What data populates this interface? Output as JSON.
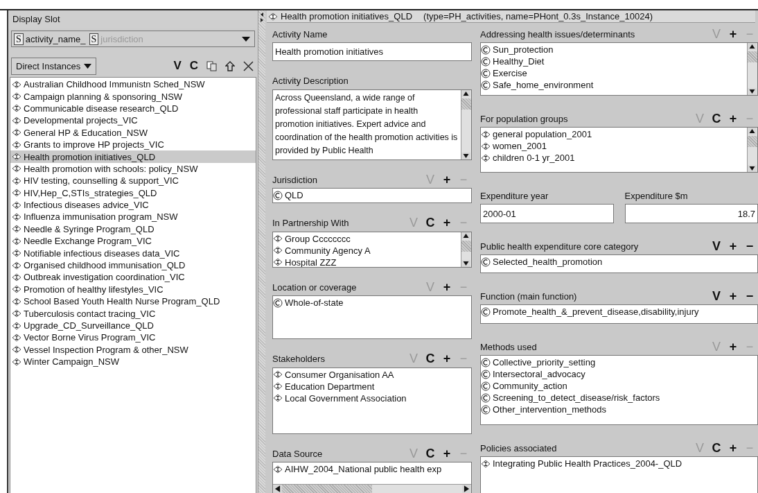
{
  "left_panel": {
    "title": "Display Slot",
    "slot_selector": {
      "slots": [
        {
          "badge": "S",
          "name": "activity_name_",
          "disabled": false
        },
        {
          "badge": "S",
          "name": "jurisdiction",
          "disabled": true
        }
      ]
    },
    "instances_dropdown": {
      "label": "Direct Instances"
    },
    "toolbar": [
      {
        "kind": "view",
        "label": "V"
      },
      {
        "kind": "create",
        "label": "C"
      },
      {
        "kind": "copy"
      },
      {
        "kind": "reference"
      },
      {
        "kind": "delete"
      }
    ],
    "instances": [
      {
        "label": "Australian Childhood Immunistn Sched_NSW",
        "selected": false
      },
      {
        "label": "Campaign planning & sponsoring_NSW",
        "selected": false
      },
      {
        "label": "Communicable disease research_QLD",
        "selected": false
      },
      {
        "label": "Developmental projects_VIC",
        "selected": false
      },
      {
        "label": "General HP & Education_NSW",
        "selected": false
      },
      {
        "label": "Grants to improve HP projects_VIC",
        "selected": false
      },
      {
        "label": "Health promotion initiatives_QLD",
        "selected": true
      },
      {
        "label": "Health promotion with schools:  policy_NSW",
        "selected": false
      },
      {
        "label": "HIV testing, counselling & support_VIC",
        "selected": false
      },
      {
        "label": "HIV,Hep_C,STIs_strategies_QLD",
        "selected": false
      },
      {
        "label": "Infectious diseases advice_VIC",
        "selected": false
      },
      {
        "label": "Influenza immunisation program_NSW",
        "selected": false
      },
      {
        "label": "Needle & Syringe Program_QLD",
        "selected": false
      },
      {
        "label": "Needle Exchange Program_VIC",
        "selected": false
      },
      {
        "label": "Notifiable infectious diseases data_VIC",
        "selected": false
      },
      {
        "label": "Organised childhood immunisation_QLD",
        "selected": false
      },
      {
        "label": "Outbreak investigation coordination_VIC",
        "selected": false
      },
      {
        "label": "Promotion of healthy lifestyles_VIC",
        "selected": false
      },
      {
        "label": "School Based Youth Health Nurse Program_QLD",
        "selected": false
      },
      {
        "label": "Tuberculosis contact tracing_VIC",
        "selected": false
      },
      {
        "label": "Upgrade_CD_Surveillance_QLD",
        "selected": false
      },
      {
        "label": "Vector Borne Virus Program_VIC",
        "selected": false
      },
      {
        "label": "Vessel Inspection Program & other_NSW",
        "selected": false
      },
      {
        "label": "Winter Campaign_NSW",
        "selected": false
      }
    ]
  },
  "form": {
    "title": "Health promotion initiatives_QLD",
    "subtitle": "(type=PH_activities, name=PHont_0.3s_Instance_10024)",
    "columns": [
      [
        {
          "kind": "text",
          "label": "Activity Name",
          "value": "Health promotion initiatives"
        },
        {
          "kind": "textarea",
          "label": "Activity Description",
          "value": "Across Queensland, a wide range of professional staff participate in health promotion initiatives. Expert advice and coordination of the health promotion activities is provided by Public Health"
        },
        {
          "kind": "list",
          "label": "Jurisdiction",
          "buttons": [
            {
              "label": "V",
              "disabled": true
            },
            {
              "label": "+",
              "disabled": false
            },
            {
              "label": "−",
              "disabled": true
            }
          ],
          "items": [
            {
              "kind": "class",
              "label": "QLD"
            }
          ]
        },
        {
          "kind": "list",
          "label": "In Partnership With",
          "scroll": true,
          "buttons": [
            {
              "label": "V",
              "disabled": true
            },
            {
              "label": "C",
              "disabled": false
            },
            {
              "label": "+",
              "disabled": false
            },
            {
              "label": "−",
              "disabled": true
            }
          ],
          "items": [
            {
              "kind": "instance",
              "label": "Group Cccccccc"
            },
            {
              "kind": "instance",
              "label": "Community Agency A"
            },
            {
              "kind": "instance",
              "label": "Hospital ZZZ"
            }
          ]
        },
        {
          "kind": "list",
          "label": "Location or coverage",
          "buttons": [
            {
              "label": "V",
              "disabled": true
            },
            {
              "label": "+",
              "disabled": false
            },
            {
              "label": "−",
              "disabled": true
            }
          ],
          "items": [
            {
              "kind": "class",
              "label": "Whole-of-state"
            }
          ]
        },
        {
          "kind": "list",
          "label": "Stakeholders",
          "buttons": [
            {
              "label": "V",
              "disabled": true
            },
            {
              "label": "C",
              "disabled": false
            },
            {
              "label": "+",
              "disabled": false
            },
            {
              "label": "−",
              "disabled": true
            }
          ],
          "items": [
            {
              "kind": "instance",
              "label": "Consumer Organisation AA"
            },
            {
              "kind": "instance",
              "label": "Education Department"
            },
            {
              "kind": "instance",
              "label": "Local Government Association"
            }
          ]
        },
        {
          "kind": "list",
          "label": "Data Source",
          "hscroll": true,
          "buttons": [
            {
              "label": "V",
              "disabled": true
            },
            {
              "label": "C",
              "disabled": false
            },
            {
              "label": "+",
              "disabled": false
            },
            {
              "label": "−",
              "disabled": true
            }
          ],
          "items": [
            {
              "kind": "instance",
              "label": "AIHW_2004_National public health exp"
            }
          ]
        }
      ],
      [
        {
          "kind": "list",
          "label": "Addressing health issues/determinants",
          "scroll": true,
          "buttons": [
            {
              "label": "V",
              "disabled": true
            },
            {
              "label": "+",
              "disabled": false
            },
            {
              "label": "−",
              "disabled": true
            }
          ],
          "items": [
            {
              "kind": "class",
              "label": "Sun_protection"
            },
            {
              "kind": "class",
              "label": "Healthy_Diet"
            },
            {
              "kind": "class",
              "label": "Exercise"
            },
            {
              "kind": "class",
              "label": "Safe_home_environment"
            }
          ]
        },
        {
          "kind": "list",
          "label": "For population groups",
          "scroll": true,
          "buttons": [
            {
              "label": "V",
              "disabled": true
            },
            {
              "label": "C",
              "disabled": false
            },
            {
              "label": "+",
              "disabled": false
            },
            {
              "label": "−",
              "disabled": true
            }
          ],
          "items": [
            {
              "kind": "instance",
              "label": "general population_2001"
            },
            {
              "kind": "instance",
              "label": "women_2001"
            },
            {
              "kind": "instance",
              "label": "children 0-1 yr_2001"
            }
          ]
        },
        {
          "kind": "pair",
          "fields": [
            {
              "kind": "text",
              "label": "Expenditure year",
              "value": "2000-01"
            },
            {
              "kind": "number",
              "label": "Expenditure $m",
              "value": "18.7"
            }
          ]
        },
        {
          "kind": "list",
          "label": "Public health expenditure core category",
          "buttons": [
            {
              "label": "V",
              "disabled": false
            },
            {
              "label": "+",
              "disabled": false
            },
            {
              "label": "−",
              "disabled": false
            }
          ],
          "items": [
            {
              "kind": "class",
              "label": "Selected_health_promotion"
            }
          ]
        },
        {
          "kind": "list",
          "label": "Function (main function)",
          "buttons": [
            {
              "label": "V",
              "disabled": false
            },
            {
              "label": "+",
              "disabled": false
            },
            {
              "label": "−",
              "disabled": false
            }
          ],
          "items": [
            {
              "kind": "class",
              "label": "Promote_health_&_prevent_disease,disability,injury"
            }
          ]
        },
        {
          "kind": "list",
          "label": "Methods used",
          "buttons": [
            {
              "label": "V",
              "disabled": true
            },
            {
              "label": "+",
              "disabled": false
            },
            {
              "label": "−",
              "disabled": true
            }
          ],
          "items": [
            {
              "kind": "class",
              "label": "Collective_priority_setting"
            },
            {
              "kind": "class",
              "label": "Intersectoral_advocacy"
            },
            {
              "kind": "class",
              "label": "Community_action"
            },
            {
              "kind": "class",
              "label": "Screening_to_detect_disease/risk_factors"
            },
            {
              "kind": "class",
              "label": "Other_intervention_methods"
            }
          ]
        },
        {
          "kind": "list",
          "label": "Policies associated",
          "buttons": [
            {
              "label": "V",
              "disabled": true
            },
            {
              "label": "C",
              "disabled": false
            },
            {
              "label": "+",
              "disabled": false
            },
            {
              "label": "−",
              "disabled": true
            }
          ],
          "items": [
            {
              "kind": "instance",
              "label": "Integrating Public Health Practices_2004-_QLD"
            }
          ]
        }
      ]
    ]
  }
}
